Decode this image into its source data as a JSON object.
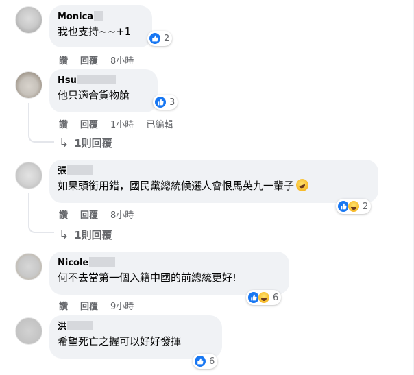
{
  "comments": [
    {
      "author": "Monica",
      "text": "我也支持~~+1",
      "reaction_count": "2",
      "actions": {
        "like": "讚",
        "reply": "回覆",
        "time": "8小時"
      }
    },
    {
      "author": "Hsu",
      "text": "他只適合貨物艙",
      "reaction_count": "3",
      "actions": {
        "like": "讚",
        "reply": "回覆",
        "time": "1小時",
        "edited": "已編輯"
      },
      "replies_label": "1則回覆"
    },
    {
      "author": "張",
      "text": "如果頭銜用錯，國民黨總統候選人會恨馬英九一輩子",
      "reaction_count": "2",
      "actions": {
        "like": "讚",
        "reply": "回覆",
        "time": "8小時"
      },
      "replies_label": "1則回覆"
    },
    {
      "author": "Nicole",
      "text": "何不去當第一個入籍中國的前總統更好!",
      "reaction_count": "6",
      "actions": {
        "like": "讚",
        "reply": "回覆",
        "time": "9小時"
      }
    },
    {
      "author": "洪",
      "text": "希望死亡之握可以好好發揮",
      "reaction_count": "6"
    }
  ],
  "icons": {
    "like": "like-icon",
    "haha": "haha-icon",
    "reply_arrow": "reply-arrow-icon",
    "laugh_emoji": "rolling-laugh-emoji-icon"
  },
  "colors": {
    "bubble": "#f0f2f5",
    "like_blue": "#1877f2",
    "meta_gray": "#65676b",
    "text": "#050505"
  }
}
